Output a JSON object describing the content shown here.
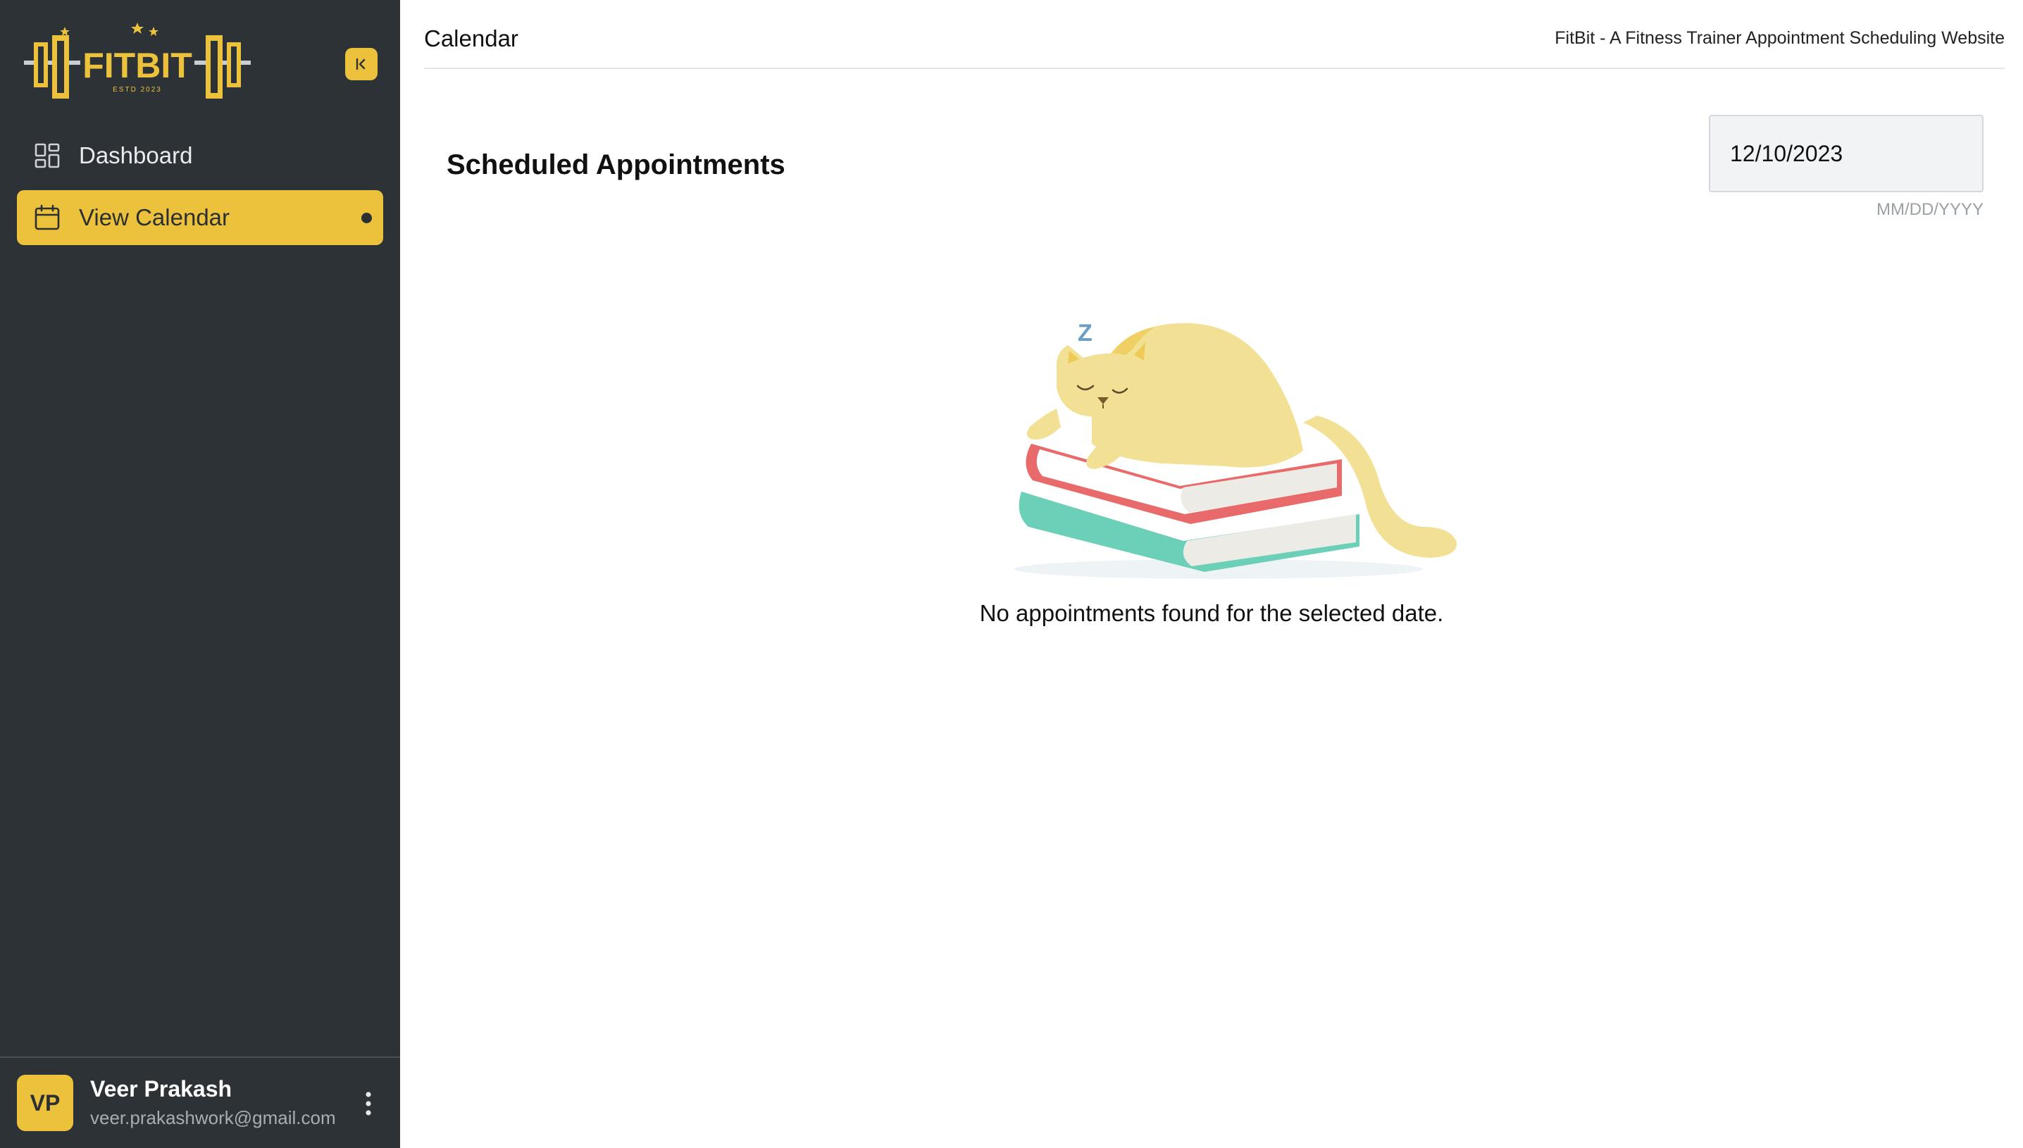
{
  "sidebar": {
    "logo": {
      "text": "FITBIT",
      "tagline": "ESTD 2023",
      "accent": "#ecc23c"
    },
    "collapse_icon": "collapse-left-icon",
    "items": [
      {
        "label": "Dashboard",
        "icon": "dashboard-grid-icon",
        "active": false
      },
      {
        "label": "View Calendar",
        "icon": "calendar-icon",
        "active": true
      }
    ],
    "user": {
      "initials": "VP",
      "name": "Veer Prakash",
      "email": "veer.prakashwork@gmail.com",
      "menu_icon": "more-vertical-icon"
    }
  },
  "header": {
    "title": "Calendar",
    "subtitle": "FitBit - A Fitness Trainer Appointment Scheduling Website"
  },
  "main": {
    "section_title": "Scheduled Appointments",
    "date_input": {
      "value": "12/10/2023",
      "hint": "MM/DD/YYYY"
    },
    "empty_state": {
      "illustration": "sleeping-cat-on-books-illustration",
      "sleep_mark": "Z",
      "message": "No appointments found for the selected date."
    }
  },
  "colors": {
    "sidebar_bg": "#2d3237",
    "accent": "#ecc23c",
    "divider": "#e4e6e9"
  }
}
